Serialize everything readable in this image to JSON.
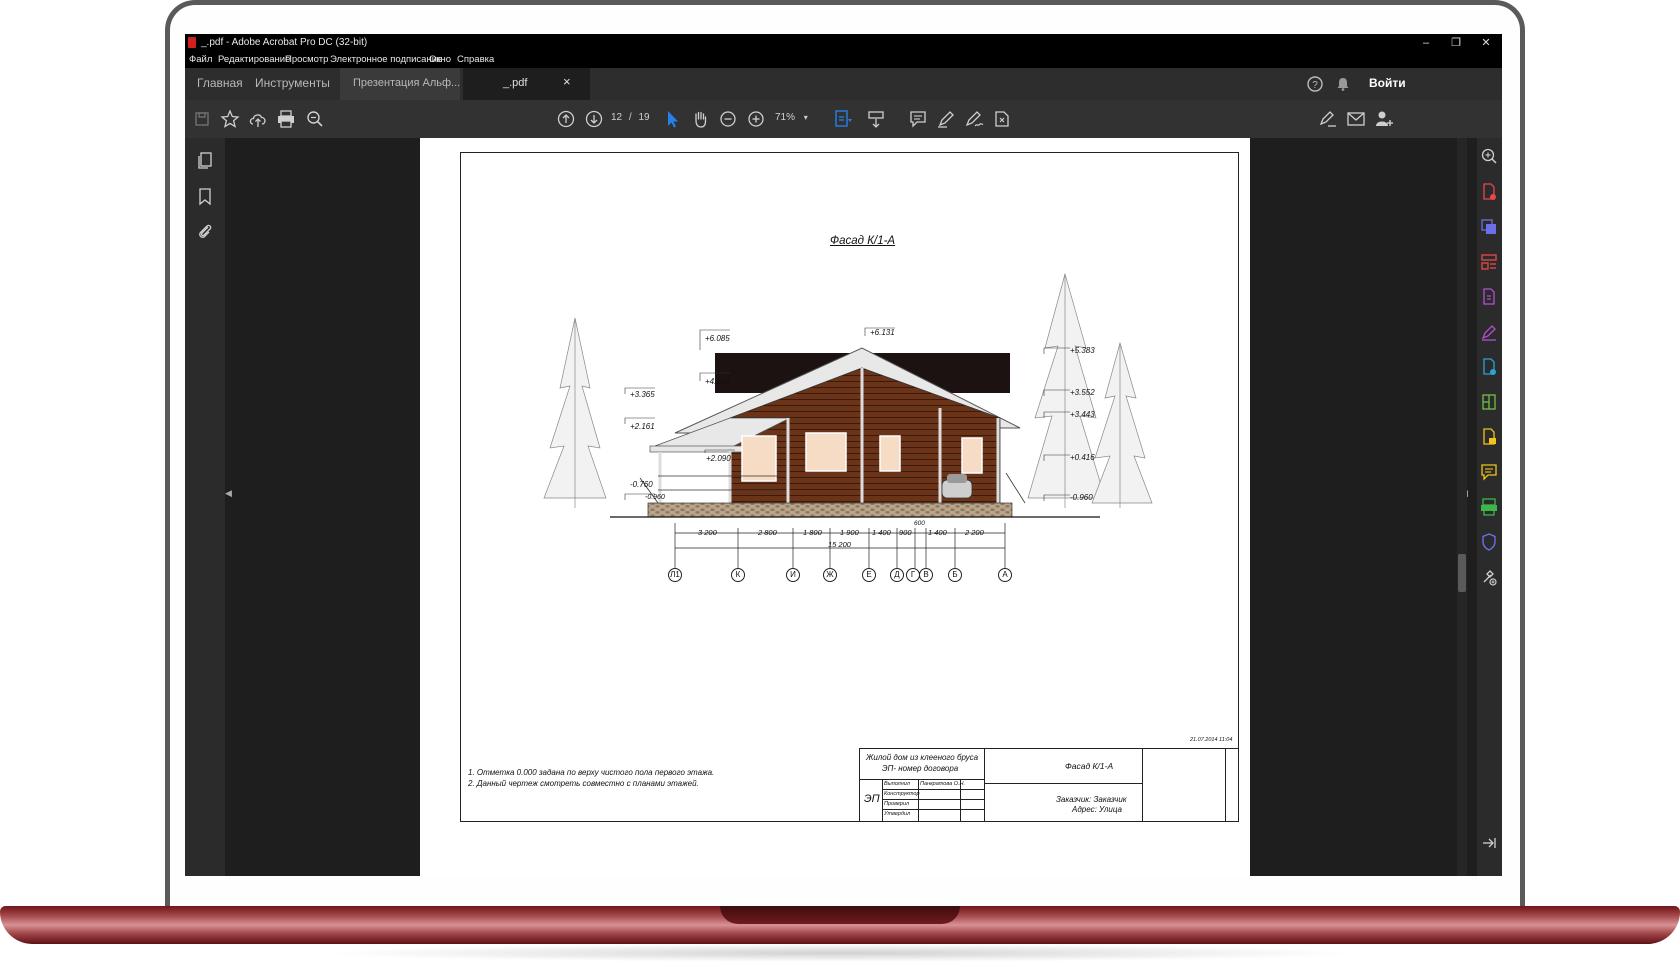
{
  "window": {
    "title": "_.pdf - Adobe Acrobat Pro DC (32-bit)",
    "controls": {
      "minimize": "–",
      "restore": "❐",
      "close": "✕"
    }
  },
  "menu": [
    "Файл",
    "Редактирование",
    "Просмотр",
    "Электронное подписание",
    "Окно",
    "Справка"
  ],
  "tabs": {
    "home": "Главная",
    "tools": "Инструменты",
    "doc1": "Презентация Альф...",
    "doc2": "_.pdf",
    "doc2_close": "×",
    "signin": "Войти"
  },
  "toolbar": {
    "page_current": "12",
    "page_sep": "/",
    "page_total": "19",
    "zoom": "71%"
  },
  "drawing": {
    "title": "Фасад К/1-А",
    "levels_left": [
      "+6.085",
      "+4.260",
      "+3.365",
      "+2.161",
      "+2.090",
      "-0.760",
      "-0.960"
    ],
    "levels_right": [
      "+5.383",
      "+3.552",
      "+3.443",
      "+0.416",
      "-0.960"
    ],
    "level_ridge": "+6.131",
    "dims": [
      "3 200",
      "2 800",
      "1 800",
      "1 900",
      "1 400",
      "900",
      "600",
      "1 400",
      "2 200"
    ],
    "dim_total": "15 200",
    "axes": [
      "Л1",
      "К",
      "И",
      "Ж",
      "Е",
      "Д",
      "Г",
      "В",
      "Б",
      "А"
    ],
    "note_small": "21.07.2014 11:04",
    "notes": [
      "1. Отметка 0.000 задана по верху чистого пола первого этажа.",
      "2. Данный чертеж смотреть совместно с планами этажей."
    ],
    "stamp": {
      "project_line1": "Жилой дом из клееного бруса",
      "project_line2": "ЭП- номер договора",
      "sheet_title": "Фасад К/1-А",
      "stage": "ЭП",
      "roles": [
        "Выполнил",
        "Конструктор",
        "Проверил",
        "Утвердил"
      ],
      "executor": "Панкратова О.Н.",
      "customer": "Заказчик:  Заказчик",
      "address": "Адрес:  Улица"
    }
  },
  "colors": {
    "accent_blue": "#2680eb",
    "screen_bg": "#1e1e1e",
    "toolbar_bg": "#323232",
    "laptop_red": "#a3474a"
  }
}
